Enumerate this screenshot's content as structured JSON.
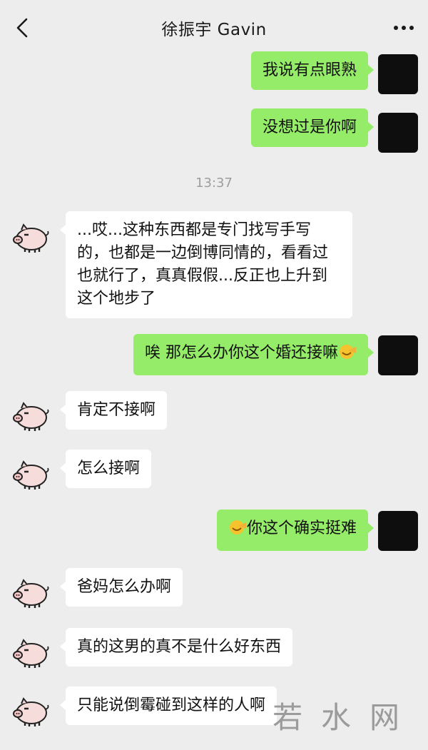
{
  "header": {
    "title": "徐振宇 Gavin"
  },
  "icons": {
    "back": "chevron-left-icon",
    "more": "more-dots-icon"
  },
  "messages": [
    {
      "side": "out",
      "text": "我说有点眼熟"
    },
    {
      "side": "out",
      "text": "没想过是你啊"
    },
    {
      "side": "in",
      "text": "...哎...这种东西都是专门找写手写的，也都是一边倒博同情的，看看过也就行了，真真假假...反正也上升到这个地步了"
    },
    {
      "side": "out",
      "text": "唉 那怎么办你这个婚还接嘛"
    },
    {
      "side": "in",
      "text": "肯定不接啊"
    },
    {
      "side": "in",
      "text": "怎么接啊"
    },
    {
      "side": "out",
      "text": "你这个确实挺难"
    },
    {
      "side": "in",
      "text": "爸妈怎么办啊"
    },
    {
      "side": "in",
      "text": "真的这男的真不是什么好东西"
    },
    {
      "side": "in",
      "text": "只能说倒霉碰到这样的人啊"
    }
  ],
  "timestamp": "13:37",
  "watermark": "若水网",
  "colors": {
    "background": "#ededed",
    "outgoing_bubble": "#95ec69",
    "incoming_bubble": "#ffffff"
  }
}
